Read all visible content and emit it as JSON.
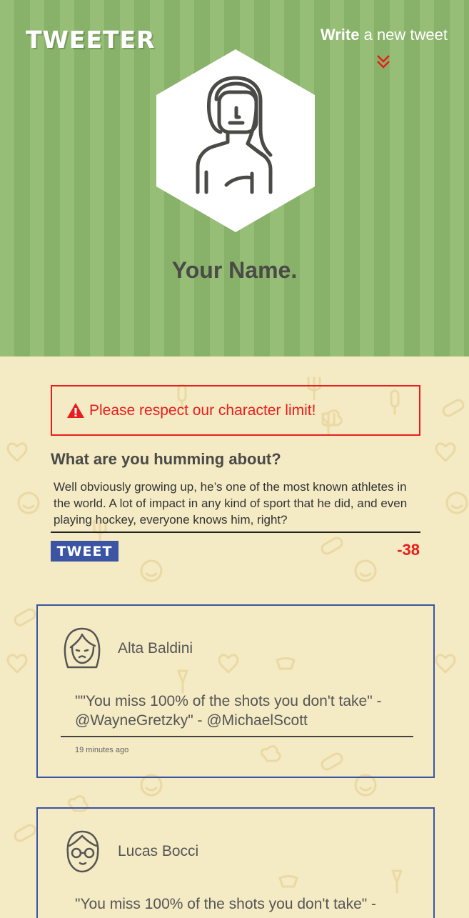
{
  "header": {
    "brand": "TWEETER",
    "compose_bold": "Write",
    "compose_rest": " a new tweet",
    "profile_name": "Your Name."
  },
  "composer": {
    "alert_text": "Please respect our character limit!",
    "label": "What are you humming about?",
    "text": "Well obviously growing up, he’s one of the most known athletes in the world. A lot of impact in any kind of sport that he did, and even playing hockey, everyone knows him, right?",
    "button_label": "TWEET",
    "counter": "-38"
  },
  "tweets": [
    {
      "user": "Alta Baldini",
      "text": "\"\"You miss 100% of the shots you don't take\" - @WayneGretzky\" - @MichaelScott",
      "time": "19 minutes ago",
      "avatar": "woman-frown-avatar-icon"
    },
    {
      "user": "Lucas Bocci",
      "text": "\"You miss 100% of the shots you don't take\" -",
      "time": "",
      "avatar": "man-glasses-avatar-icon"
    }
  ],
  "colors": {
    "hero_green": "#8fba6f",
    "background_cream": "#f4eac4",
    "alert_red": "#e81d1d",
    "button_blue": "#3b54a4",
    "text_dark": "#4a4a46"
  }
}
